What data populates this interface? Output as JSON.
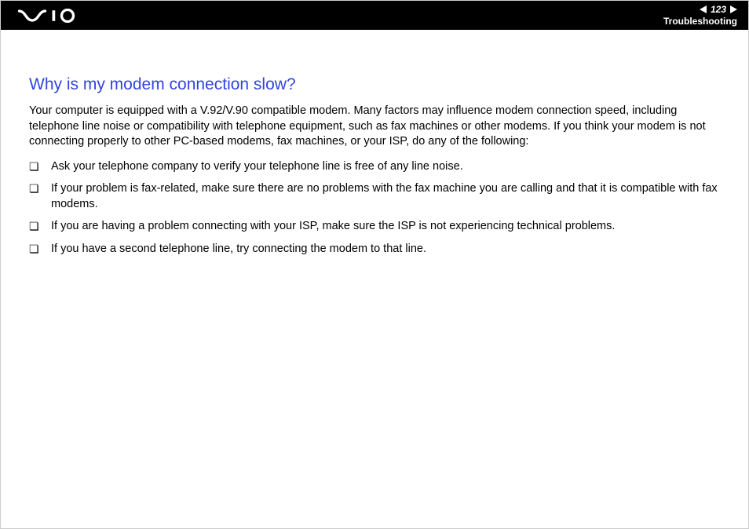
{
  "header": {
    "page_number": "123",
    "section": "Troubleshooting"
  },
  "content": {
    "heading": "Why is my modem connection slow?",
    "paragraph": "Your computer is equipped with a V.92/V.90 compatible modem. Many factors may influence modem connection speed, including telephone line noise or compatibility with telephone equipment, such as fax machines or other modems. If you think your modem is not connecting properly to other PC-based modems, fax machines, or your ISP, do any of the following:",
    "bullets": [
      "Ask your telephone company to verify your telephone line is free of any line noise.",
      "If your problem is fax-related, make sure there are no problems with the fax machine you are calling and that it is compatible with fax modems.",
      "If you are having a problem connecting with your ISP, make sure the ISP is not experiencing technical problems.",
      "If you have a second telephone line, try connecting the modem to that line."
    ]
  }
}
